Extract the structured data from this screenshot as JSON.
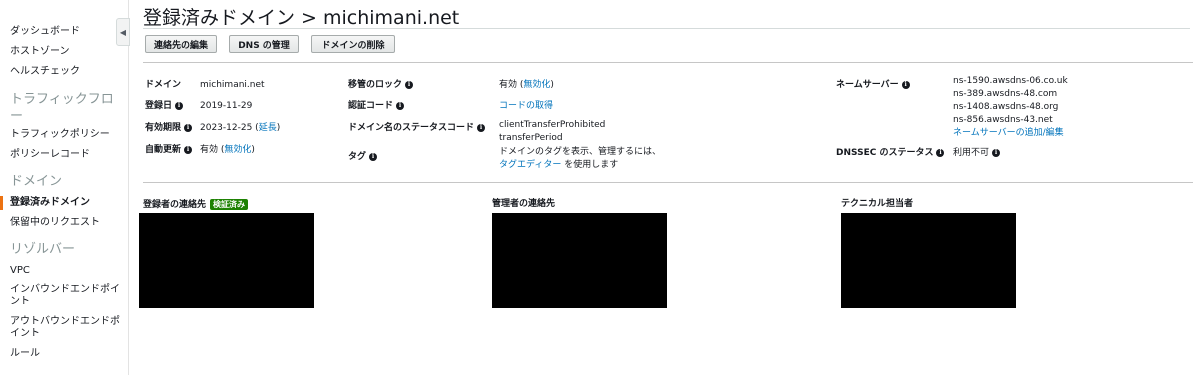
{
  "sidebar": {
    "items": [
      {
        "label": "ダッシュボード"
      },
      {
        "label": "ホストゾーン"
      },
      {
        "label": "ヘルスチェック"
      }
    ],
    "traffic_flow": {
      "heading": "トラフィックフロー",
      "items": [
        {
          "label": "トラフィックポリシー"
        },
        {
          "label": "ポリシーレコード"
        }
      ]
    },
    "domains": {
      "heading": "ドメイン",
      "items": [
        {
          "label": "登録済みドメイン"
        },
        {
          "label": "保留中のリクエスト"
        }
      ]
    },
    "resolver": {
      "heading": "リゾルバー",
      "items": [
        {
          "label": "VPC"
        },
        {
          "label": "インバウンドエンドポイント"
        },
        {
          "label": "アウトバウンドエンドポイント"
        },
        {
          "label": "ルール"
        }
      ]
    },
    "collapse_icon": "chevron-left-icon"
  },
  "header": {
    "title": "登録済みドメイン > michimani.net"
  },
  "toolbar": {
    "edit_contacts": "連絡先の編集",
    "manage_dns": "DNS の管理",
    "delete_domain": "ドメインの削除"
  },
  "details": {
    "domain_label": "ドメイン",
    "domain_value": "michimani.net",
    "registered_label": "登録日",
    "registered_value": "2019-11-29",
    "expires_label": "有効期限",
    "expires_value": "2023-12-25",
    "expires_link": "延長",
    "auto_renew_label": "自動更新",
    "auto_renew_value": "有効",
    "auto_renew_link": "無効化",
    "transfer_lock_label": "移管のロック",
    "transfer_lock_value": "有効",
    "transfer_lock_link": "無効化",
    "auth_code_label": "認証コード",
    "auth_code_link": "コードの取得",
    "status_code_label": "ドメイン名のステータスコード",
    "status_codes": [
      "clientTransferProhibited",
      "transferPeriod"
    ],
    "tags_label": "タグ",
    "tags_text_1": "ドメインのタグを表示、管理するには、",
    "tags_link": "タグエディター",
    "tags_text_2": " を使用します",
    "nameservers_label": "ネームサーバー",
    "nameservers": [
      "ns-1590.awsdns-06.co.uk",
      "ns-389.awsdns-48.com",
      "ns-1408.awsdns-48.org",
      "ns-856.awsdns-43.net"
    ],
    "nameservers_link": "ネームサーバーの追加/編集",
    "dnssec_label": "DNSSEC のステータス",
    "dnssec_value": "利用不可"
  },
  "contacts": {
    "registrant": "登録者の連絡先",
    "verified_badge": "検証済み",
    "admin": "管理者の連絡先",
    "tech": "テクニカル担当者"
  },
  "colors": {
    "accent": "#ec7211",
    "link": "#0073bb",
    "verified": "#1d8102"
  }
}
